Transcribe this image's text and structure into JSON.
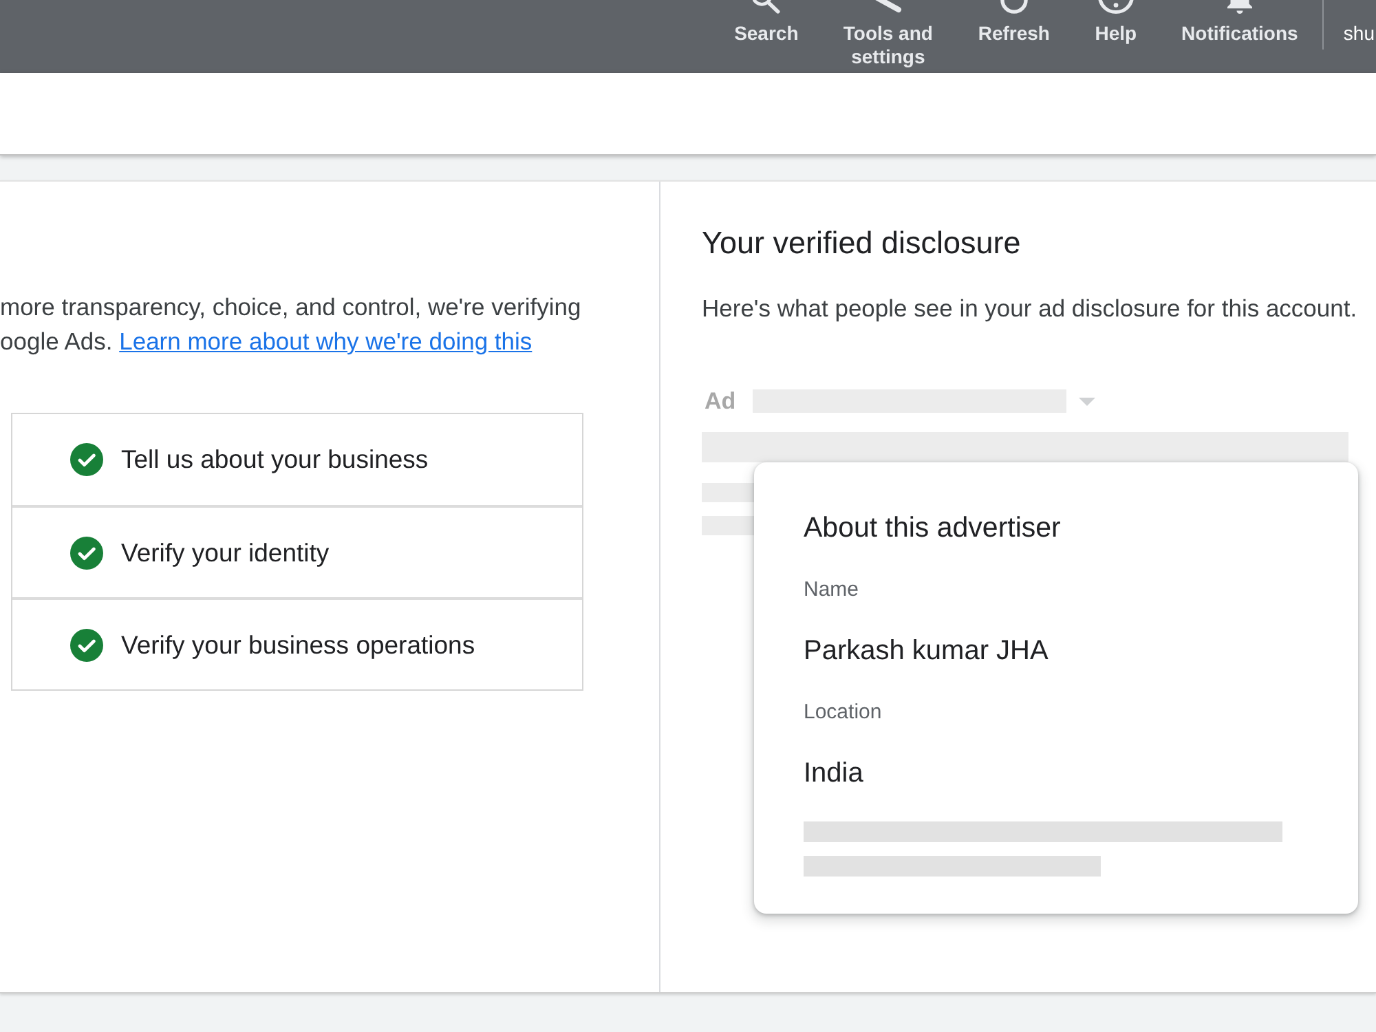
{
  "header": {
    "actions": [
      {
        "label": "Search"
      },
      {
        "label": "Tools and settings"
      },
      {
        "label": "Refresh"
      },
      {
        "label": "Help"
      },
      {
        "label": "Notifications"
      }
    ],
    "account": "shu"
  },
  "verification": {
    "intro": {
      "text": "more transparency, choice, and control, we're verifying oogle Ads.",
      "link": "Learn more about why we're doing this"
    },
    "steps": [
      {
        "label": "Tell us about your business",
        "completed": true
      },
      {
        "label": "Verify your identity",
        "completed": true
      },
      {
        "label": "Verify your business operations",
        "completed": true
      }
    ]
  },
  "disclosure": {
    "title": "Your verified disclosure",
    "description": "Here's what people see in your ad disclosure for this account.",
    "ad_preview": {
      "ad_label": "Ad",
      "advertiser_card": {
        "title": "About this advertiser",
        "fields": [
          {
            "label": "Name",
            "value": "Parkash kumar JHA"
          },
          {
            "label": "Location",
            "value": "India"
          }
        ]
      }
    }
  }
}
